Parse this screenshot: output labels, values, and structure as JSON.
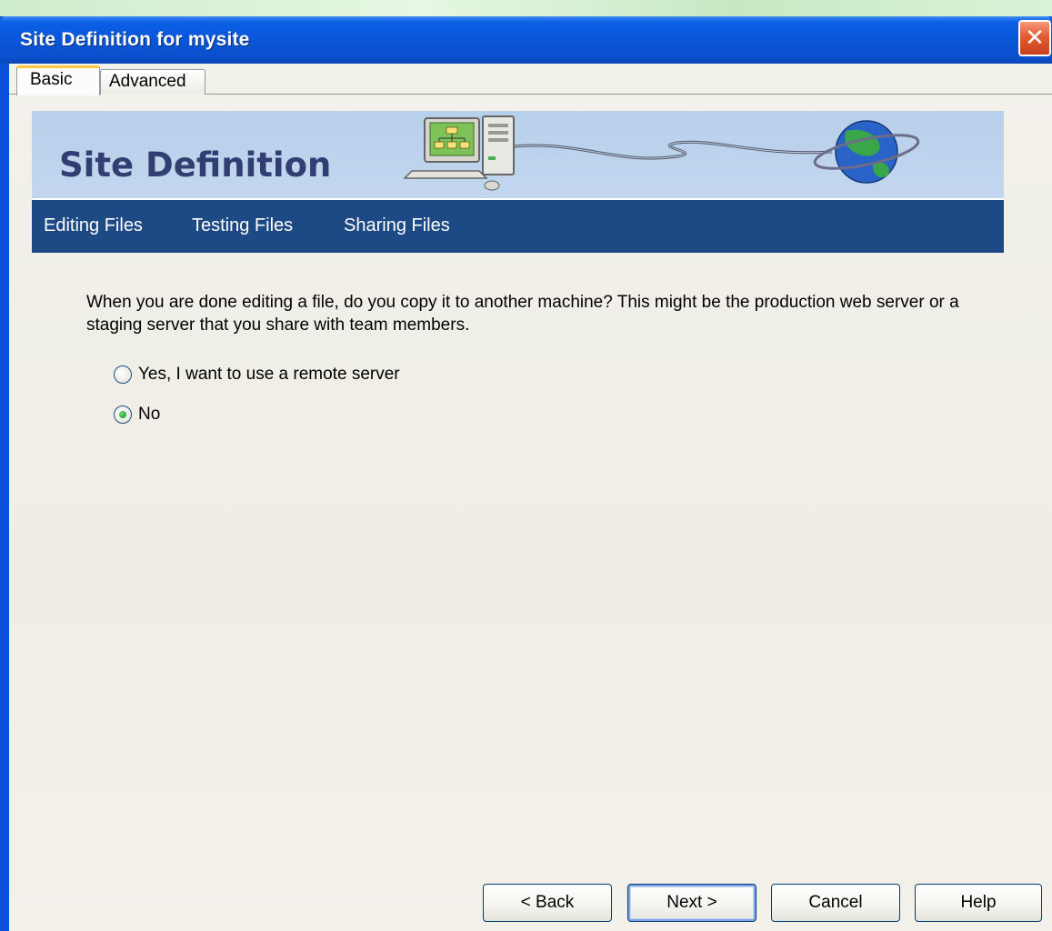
{
  "window": {
    "title": "Site Definition for mysite",
    "close_glyph": "✕"
  },
  "tabs": [
    {
      "label": "Basic",
      "selected": true
    },
    {
      "label": "Advanced",
      "selected": false
    }
  ],
  "banner": {
    "title": "Site Definition",
    "graphic": "computer-to-globe-icon"
  },
  "steps": [
    {
      "label": "Editing Files"
    },
    {
      "label": "Testing Files"
    },
    {
      "label": "Sharing Files"
    }
  ],
  "question": "When you are done editing a file, do you copy it to another machine? This might be the production web server or a staging server that you share with team members.",
  "options": [
    {
      "label": "Yes, I want to use a remote server",
      "selected": false
    },
    {
      "label": "No",
      "selected": true
    }
  ],
  "buttons": {
    "back": "< Back",
    "next": "Next >",
    "cancel": "Cancel",
    "help": "Help"
  },
  "colors": {
    "titlebar": "#0a56d8",
    "banner_bg": "#bcd2ec",
    "nav_bg": "#1d4a84",
    "banner_title": "#2f3f72",
    "active_tab_accent": "#ffc83c"
  }
}
